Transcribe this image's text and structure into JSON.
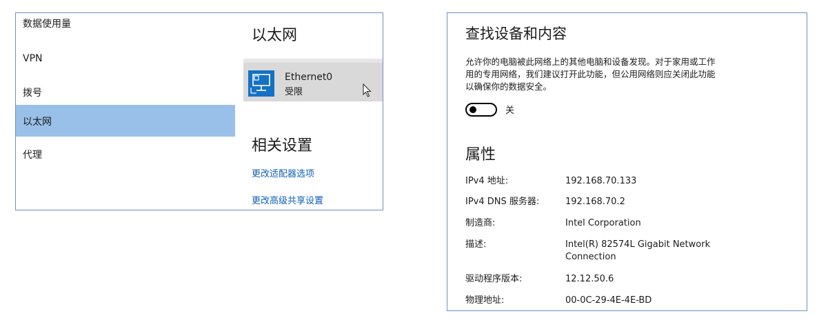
{
  "sidebar": {
    "items": [
      {
        "label": "数据使用量"
      },
      {
        "label": "VPN"
      },
      {
        "label": "拨号"
      },
      {
        "label": "以太网"
      },
      {
        "label": "代理"
      }
    ],
    "selected_color": "#99c0e8"
  },
  "ethernet_panel": {
    "title": "以太网",
    "adapter": {
      "name": "Ethernet0",
      "status": "受限",
      "icon": "network-monitor-icon"
    },
    "related_title": "相关设置",
    "links": [
      {
        "label": "更改适配器选项"
      },
      {
        "label": "更改高级共享设置"
      }
    ],
    "link_color": "#0f5fb8",
    "accent_color": "#1571c4"
  },
  "properties_panel": {
    "find_title": "查找设备和内容",
    "find_description_lines": [
      "允许你的电脑被此网络上的其他电脑和设备发现。对于家用或工作",
      "用的专用网络，我们建议打开此功能，但公用网络则应关闭此功能",
      "以确保你的数据安全。"
    ],
    "toggle_state": "关",
    "properties_title": "属性",
    "properties": [
      {
        "key": "IPv4 地址:",
        "value": "192.168.70.133"
      },
      {
        "key": "IPv4 DNS 服务器:",
        "value": "192.168.70.2"
      },
      {
        "key": "制造商:",
        "value": "Intel Corporation"
      },
      {
        "key": "描述:",
        "value_lines": [
          "Intel(R) 82574L Gigabit Network",
          "Connection"
        ]
      },
      {
        "key": "驱动程序版本:",
        "value": "12.12.50.6"
      },
      {
        "key": "物理地址:",
        "value": "00-0C-29-4E-4E-BD"
      }
    ]
  }
}
